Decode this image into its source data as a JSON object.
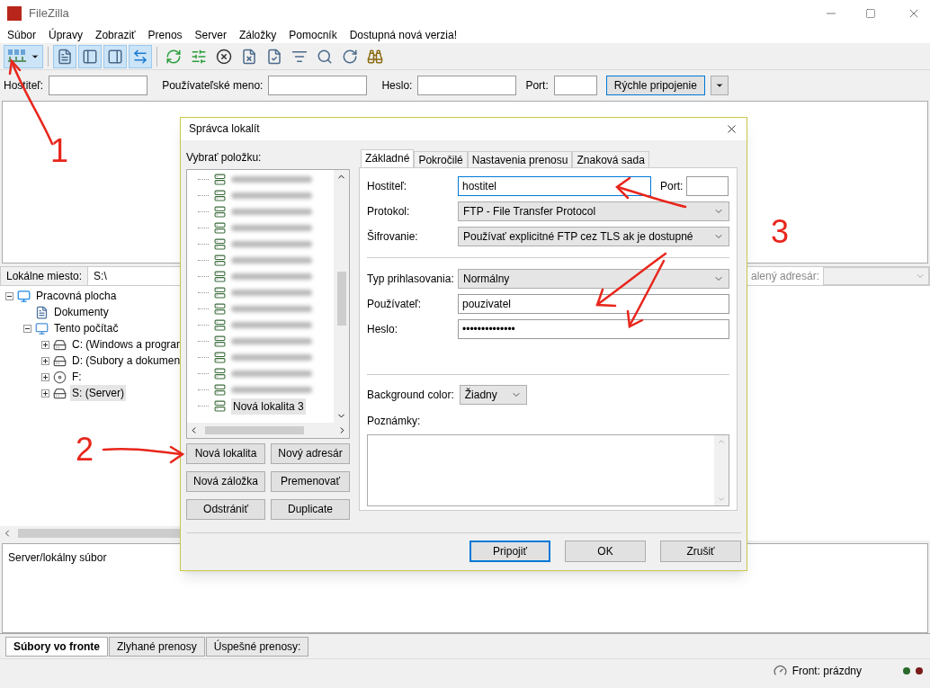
{
  "window": {
    "title": "FileZilla"
  },
  "menu": [
    "Súbor",
    "Úpravy",
    "Zobraziť",
    "Prenos",
    "Server",
    "Záložky",
    "Pomocník",
    "Dostupná nová verzia!"
  ],
  "toolbar": [
    {
      "kind": "site-manager",
      "on": true
    },
    {
      "kind": "log",
      "on": true
    },
    {
      "kind": "local-tree",
      "on": true
    },
    {
      "kind": "remote-tree",
      "on": true
    },
    {
      "kind": "queue",
      "on": true
    },
    {
      "kind": "refresh",
      "on": false
    },
    {
      "kind": "filters",
      "on": false
    },
    {
      "kind": "cancel",
      "on": false
    },
    {
      "kind": "disconnect",
      "on": false
    },
    {
      "kind": "reconnect",
      "on": false
    },
    {
      "kind": "list",
      "on": false
    },
    {
      "kind": "compare",
      "on": false
    },
    {
      "kind": "sync",
      "on": false
    },
    {
      "kind": "find",
      "on": false
    }
  ],
  "quickconnect": {
    "host_label": "Hostiteľ:",
    "user_label": "Používateľské meno:",
    "password_label": "Heslo:",
    "port_label": "Port:",
    "button": "Rýchle pripojenie"
  },
  "local": {
    "label": "Lokálne miesto:",
    "path": "S:\\",
    "tree": [
      {
        "label": "Pracovná plocha",
        "kind": "desktop",
        "selected": false,
        "expanded": true,
        "children": [
          {
            "label": "Dokumenty",
            "kind": "documents",
            "selected": false
          },
          {
            "label": "Tento počítač",
            "kind": "computer",
            "selected": false,
            "expanded": true,
            "children": [
              {
                "label": "C: (Windows a progran",
                "kind": "system-drive",
                "selected": false,
                "expanded": false
              },
              {
                "label": "D: (Subory a dokumen",
                "kind": "drive",
                "selected": false,
                "expanded": false
              },
              {
                "label": "F:",
                "kind": "optical",
                "selected": false,
                "expanded": false
              },
              {
                "label": "S: (Server)",
                "kind": "drive",
                "selected": true,
                "expanded": false
              }
            ]
          }
        ]
      }
    ]
  },
  "remote": {
    "label": "alený adresár:"
  },
  "queue": {
    "columns": [
      "Server/lokálny súbor"
    ]
  },
  "queue_tabs": [
    {
      "label": "Súbory vo fronte",
      "selected": true
    },
    {
      "label": "Zlyhané prenosy",
      "selected": false
    },
    {
      "label": "Úspešné prenosy:",
      "selected": false
    }
  ],
  "status_bar": {
    "queue": "Front: prázdny"
  },
  "dialog": {
    "title": "Správca lokalít",
    "select_label": "Vybrať položku:",
    "sites": [
      {
        "kind": "blurred",
        "selected": false
      },
      {
        "kind": "blurred",
        "selected": false
      },
      {
        "kind": "blurred",
        "selected": false
      },
      {
        "kind": "blurred",
        "selected": false
      },
      {
        "kind": "blurred",
        "selected": false
      },
      {
        "kind": "blurred",
        "selected": false
      },
      {
        "kind": "blurred",
        "selected": false
      },
      {
        "kind": "blurred",
        "selected": false
      },
      {
        "kind": "blurred",
        "selected": false
      },
      {
        "kind": "blurred",
        "selected": false
      },
      {
        "kind": "blurred",
        "selected": false
      },
      {
        "kind": "blurred",
        "selected": false
      },
      {
        "kind": "blurred",
        "selected": false
      },
      {
        "kind": "blurred",
        "selected": false
      },
      {
        "kind": "site",
        "label": "Nová lokalita 3",
        "selected": true
      }
    ],
    "buttons": [
      "Nová lokalita",
      "Nový adresár",
      "Nová záložka",
      "Premenovať",
      "Odstrániť",
      "Duplicate"
    ],
    "tabs": [
      {
        "label": "Základné",
        "selected": true
      },
      {
        "label": "Pokročilé",
        "selected": false
      },
      {
        "label": "Nastavenia prenosu",
        "selected": false
      },
      {
        "label": "Znaková sada",
        "selected": false
      }
    ],
    "host": {
      "label": "Hostiteľ:",
      "value": "hostitel",
      "focused": true
    },
    "port": {
      "label": "Port:"
    },
    "protocol": {
      "label": "Protokol:",
      "value": "FTP - File Transfer Protocol"
    },
    "encryption": {
      "label": "Šifrovanie:",
      "value": "Používať explicitné FTP cez TLS ak je dostupné"
    },
    "logon_type": {
      "label": "Typ prihlasovania:",
      "value": "Normálny"
    },
    "user": {
      "label": "Používateľ:",
      "value": "pouzivatel"
    },
    "password": {
      "label": "Heslo:",
      "value": "••••••••••••••"
    },
    "background_color": {
      "label": "Background color:",
      "value": "Žiadny"
    },
    "notes": {
      "label": "Poznámky:"
    },
    "footer": [
      {
        "label": "Pripojiť",
        "default": true
      },
      {
        "label": "OK",
        "default": false
      },
      {
        "label": "Zrušiť",
        "default": false
      }
    ]
  },
  "annotations": [
    {
      "label": "1"
    },
    {
      "label": "2"
    },
    {
      "label": "3"
    }
  ]
}
